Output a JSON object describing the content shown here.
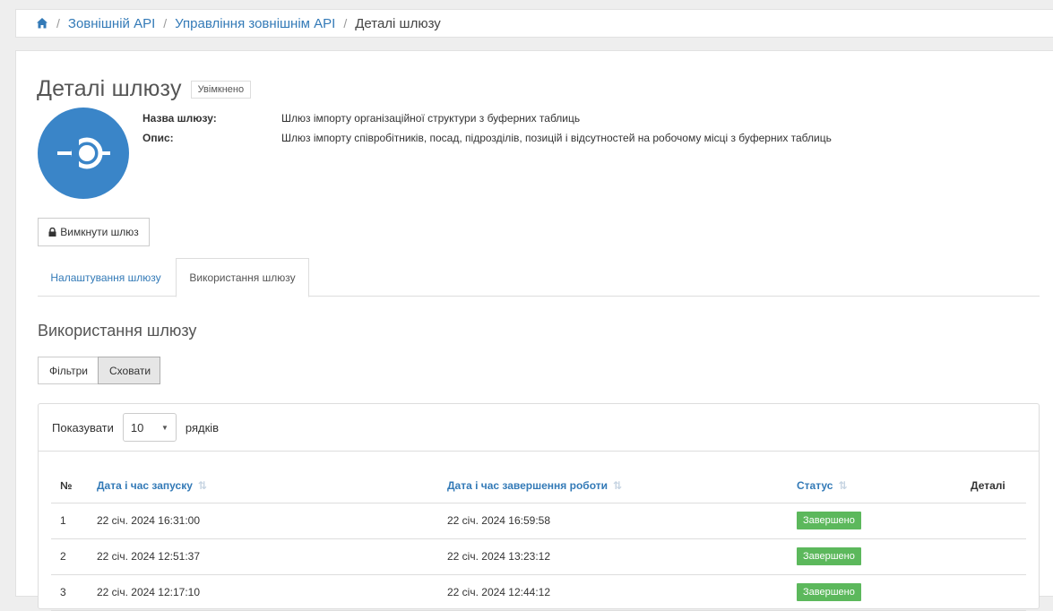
{
  "breadcrumb": {
    "home_icon": "home-icon",
    "items": [
      "Зовнішній API",
      "Управління зовнішнім API"
    ],
    "current": "Деталі шлюзу",
    "separator": "/"
  },
  "header": {
    "title": "Деталі шлюзу",
    "state_badge": "Увімкнено"
  },
  "gateway": {
    "name_label": "Назва шлюзу:",
    "name_value": "Шлюз імпорту організаційної структури з буферних таблиць",
    "desc_label": "Опис:",
    "desc_value": "Шлюз імпорту співробітників, посад, підрозділів, позицій і відсутностей на робочому місці з буферних таблиць",
    "icon": "gateway-icon",
    "icon_color": "#3a85c8"
  },
  "actions": {
    "disable_label": "Вимкнути шлюз",
    "disable_icon": "lock-icon"
  },
  "tabs": [
    {
      "label": "Налаштування шлюзу",
      "active": false
    },
    {
      "label": "Використання шлюзу",
      "active": true
    }
  ],
  "usage": {
    "title": "Використання шлюзу",
    "filters_label": "Фільтри",
    "hide_label": "Сховати",
    "show_prefix": "Показувати",
    "page_size": "10",
    "show_suffix": "рядків",
    "columns": [
      "№",
      "Дата і час запуску",
      "Дата і час завершення роботи",
      "Статус",
      "Деталі"
    ],
    "rows": [
      {
        "num": "1",
        "start": "22 січ. 2024 16:31:00",
        "end": "22 січ. 2024 16:59:58",
        "status": "Завершено"
      },
      {
        "num": "2",
        "start": "22 січ. 2024 12:51:37",
        "end": "22 січ. 2024 13:23:12",
        "status": "Завершено"
      },
      {
        "num": "3",
        "start": "22 січ. 2024 12:17:10",
        "end": "22 січ. 2024 12:44:12",
        "status": "Завершено"
      }
    ],
    "status_color": "#5cb85c"
  }
}
